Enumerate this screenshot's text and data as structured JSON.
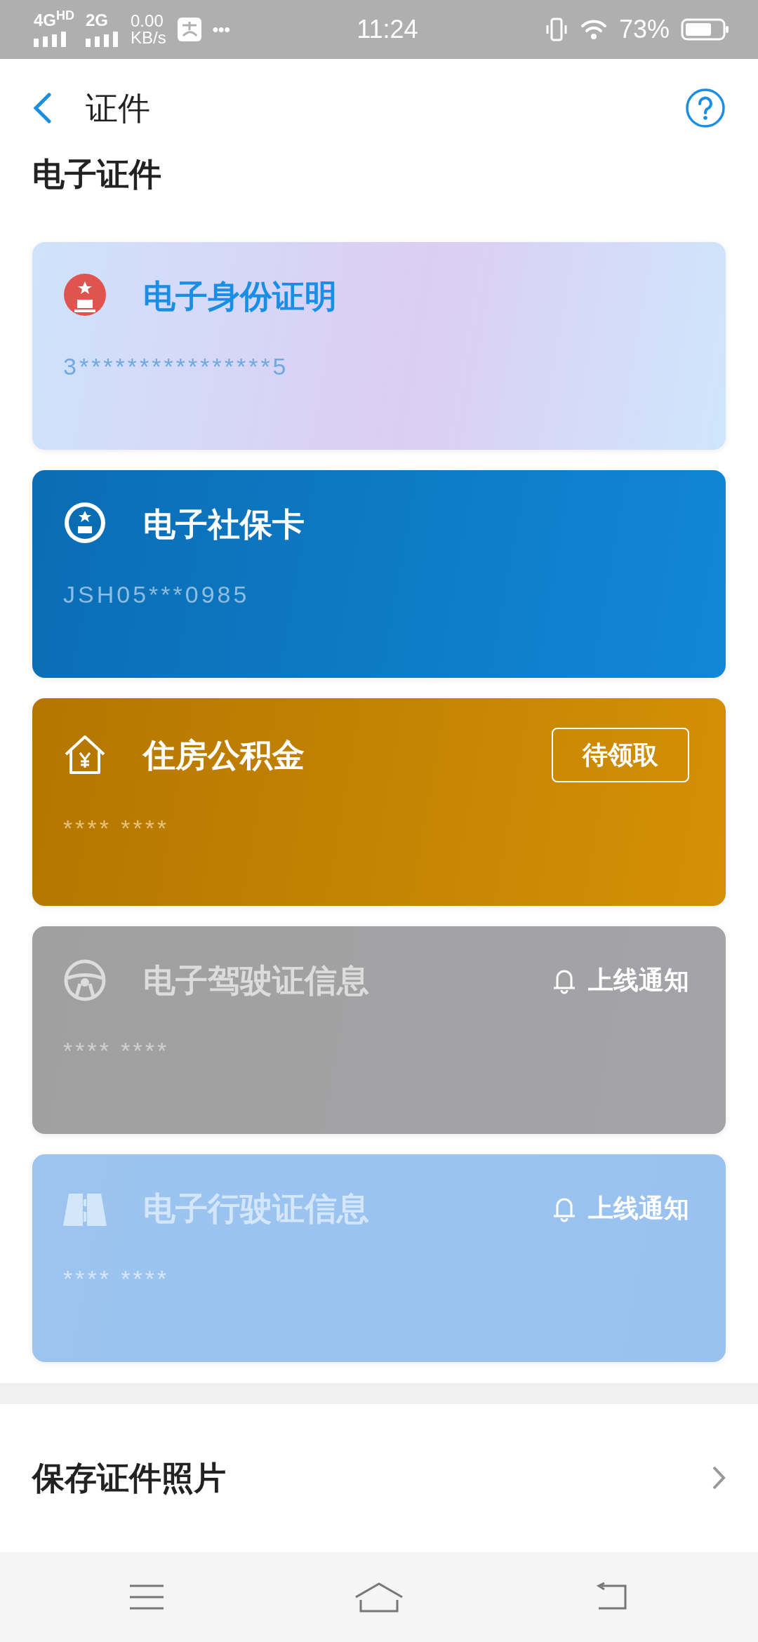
{
  "status_bar": {
    "network_1": "4G$^{HD}$",
    "network_2": "2G",
    "speed": "0.00",
    "speed_unit": "KB/s",
    "more": "•••",
    "time": "11:24",
    "battery": "73%"
  },
  "header": {
    "title": "证件"
  },
  "section_title": "电子证件",
  "cards": [
    {
      "kind": "id",
      "title": "电子身份证明",
      "number": "3****************5"
    },
    {
      "kind": "social",
      "title": "电子社保卡",
      "number": "JSH05***0985"
    },
    {
      "kind": "fund",
      "title": "住房公积金",
      "number": "**** ****",
      "action": {
        "kind": "claim",
        "label": "待领取"
      }
    },
    {
      "kind": "drive",
      "title": "电子驾驶证信息",
      "number": "**** ****",
      "action": {
        "kind": "notify",
        "label": "上线通知"
      }
    },
    {
      "kind": "vehicle",
      "title": "电子行驶证信息",
      "number": "**** ****",
      "action": {
        "kind": "notify",
        "label": "上线通知"
      }
    }
  ],
  "save_row": {
    "label": "保存证件照片"
  }
}
